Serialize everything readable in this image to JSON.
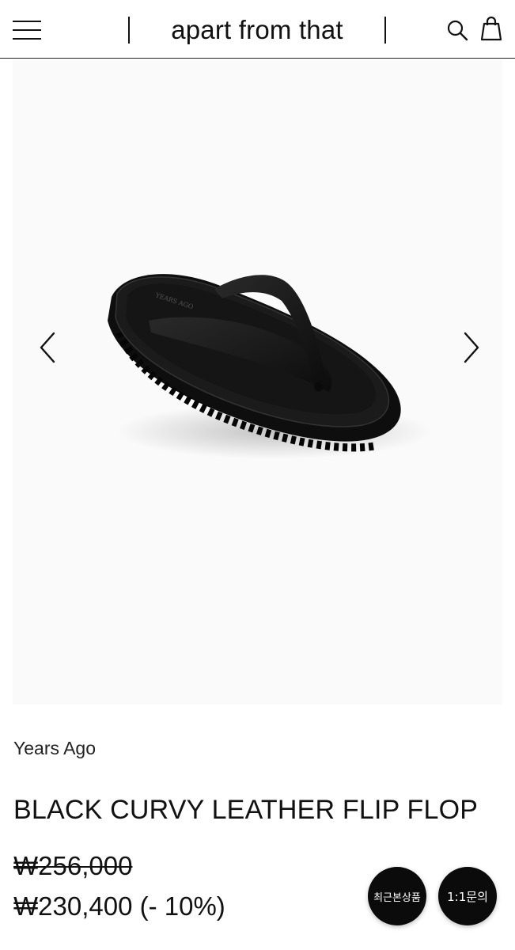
{
  "header": {
    "logo": "apart from that",
    "menu_icon": "hamburger-menu-icon",
    "search_icon": "search-icon",
    "cart_icon": "shopping-bag-icon"
  },
  "gallery": {
    "image_description_icon": "sandal-product-image",
    "prev_icon": "chevron-left-icon",
    "next_icon": "chevron-right-icon"
  },
  "product": {
    "brand": "Years Ago",
    "title": "BLACK CURVY LEATHER FLIP FLOP",
    "original_price": "₩256,000",
    "sale_price": "₩230,400 (- 10%)"
  },
  "floating": {
    "recent_label": "최근본상품",
    "inquiry_label": "1:1문의"
  }
}
